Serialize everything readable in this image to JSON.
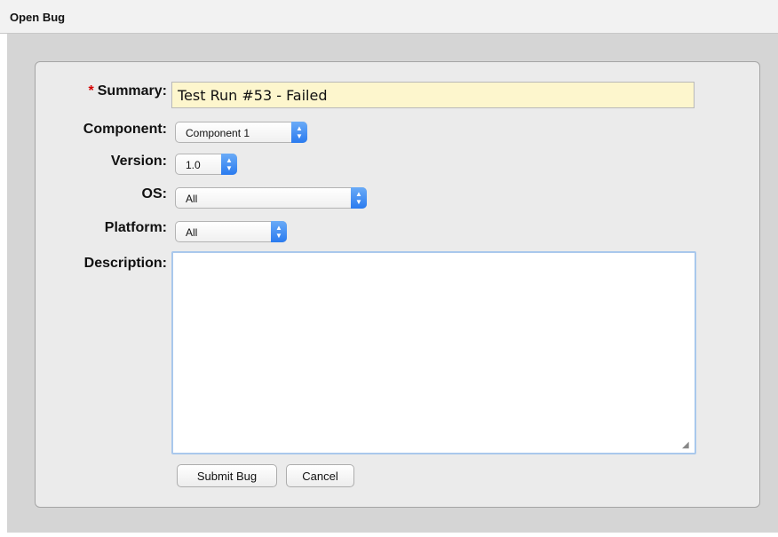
{
  "window": {
    "title": "Open Bug"
  },
  "form": {
    "summary": {
      "required_marker": "*",
      "label": "Summary:",
      "value": "Test Run #53 - Failed"
    },
    "component": {
      "label": "Component:",
      "selected": "Component 1"
    },
    "version": {
      "label": "Version:",
      "selected": "1.0"
    },
    "os": {
      "label": "OS:",
      "selected": "All"
    },
    "platform": {
      "label": "Platform:",
      "selected": "All"
    },
    "description": {
      "label": "Description:",
      "value": ""
    },
    "buttons": {
      "submit": "Submit Bug",
      "cancel": "Cancel"
    }
  },
  "colors": {
    "required": "#d40000",
    "summary_bg": "#fdf6cd",
    "select_accent": "#2a7bef"
  }
}
